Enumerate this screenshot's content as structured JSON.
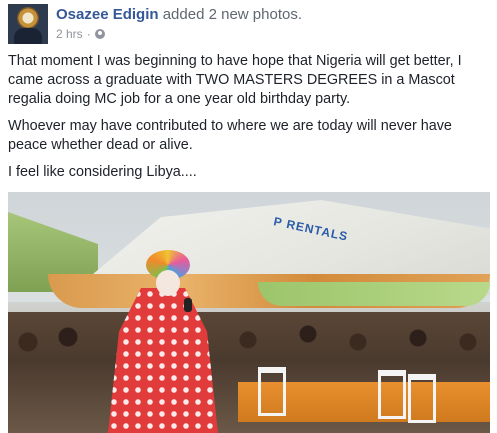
{
  "post": {
    "author": "Osazee Edigin",
    "action": "added 2 new photos.",
    "time": "2 hrs",
    "separator": "·",
    "privacy_icon": "globe-icon",
    "paragraphs": [
      "That moment I was beginning to have hope that Nigeria will get better, I came across a graduate with TWO MASTERS DEGREES in a Mascot regalia doing MC job for a one year old birthday party.",
      "Whoever may have contributed to where we are today will never have peace whether dead or alive.",
      "I feel like considering Libya...."
    ]
  },
  "photo": {
    "tent_text": "P RENTALS"
  },
  "colors": {
    "author": "#365899",
    "meta": "#90949c",
    "text": "#1d2129"
  }
}
